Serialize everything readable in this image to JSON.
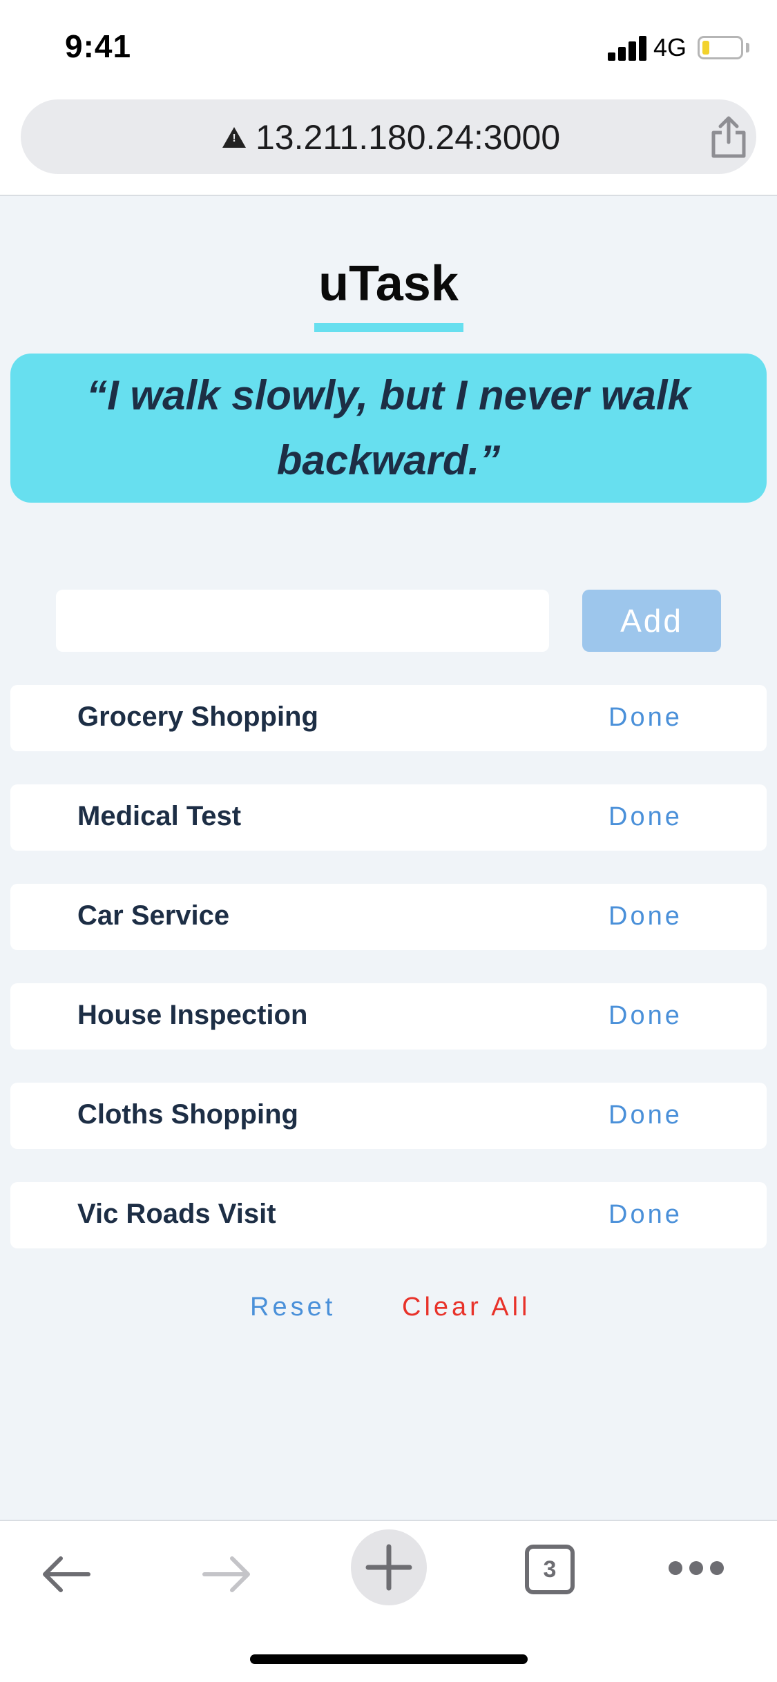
{
  "status_bar": {
    "time": "9:41",
    "network": "4G"
  },
  "browser": {
    "url": "13.211.180.24:3000",
    "tab_count": "3"
  },
  "app": {
    "title": "uTask",
    "quote": "“I walk slowly, but I never walk backward.”",
    "input_value": "",
    "add_label": "Add",
    "tasks": [
      {
        "label": "Grocery Shopping",
        "action": "Done"
      },
      {
        "label": "Medical Test",
        "action": "Done"
      },
      {
        "label": "Car Service",
        "action": "Done"
      },
      {
        "label": "House Inspection",
        "action": "Done"
      },
      {
        "label": "Cloths Shopping",
        "action": "Done"
      },
      {
        "label": "Vic Roads Visit",
        "action": "Done"
      }
    ],
    "reset_label": "Reset",
    "clear_label": "Clear All"
  },
  "colors": {
    "accent_cyan": "#67dfef",
    "link_blue": "#4a90d9",
    "danger_red": "#e8322a",
    "add_button": "#9dc6ec",
    "text_dark": "#1d2e45"
  },
  "icons": {
    "back": "arrow-left-icon",
    "forward": "arrow-right-icon",
    "new_tab": "plus-icon",
    "tabs": "tab-count-icon",
    "menu": "ellipsis-icon",
    "share": "share-icon",
    "warning": "warning-icon"
  }
}
